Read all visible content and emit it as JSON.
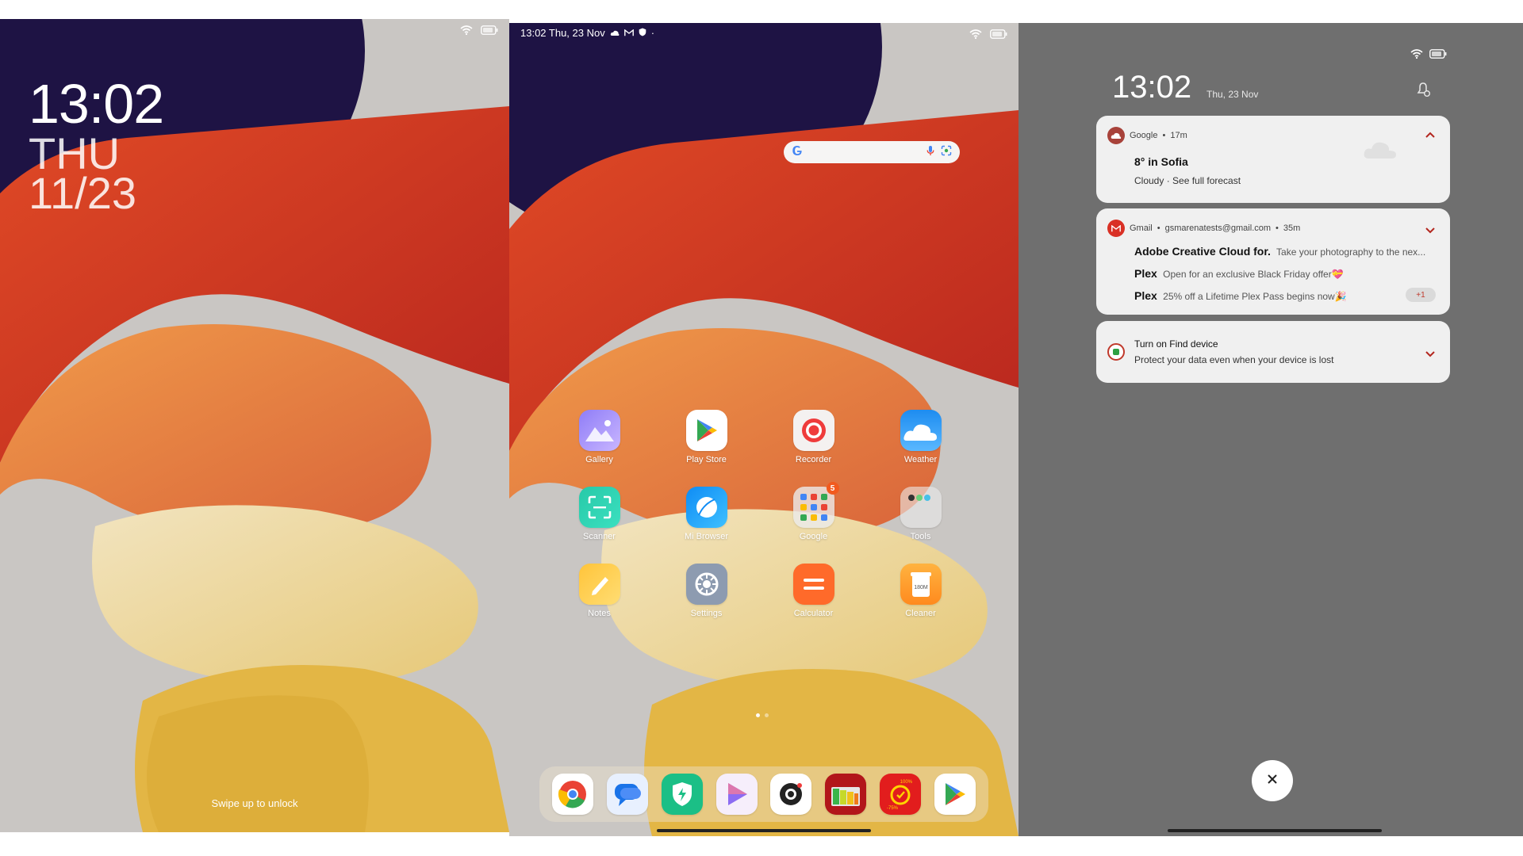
{
  "lock": {
    "time": "13:02",
    "day": "THU",
    "date": "11/23",
    "hint": "Swipe up to unlock"
  },
  "home": {
    "status": {
      "time_date": "13:02 Thu, 23 Nov",
      "extra": "·"
    },
    "apps": [
      {
        "label": "Gallery",
        "icon": "gallery-icon"
      },
      {
        "label": "Play Store",
        "icon": "play-store-icon"
      },
      {
        "label": "Recorder",
        "icon": "recorder-icon"
      },
      {
        "label": "Weather",
        "icon": "weather-icon"
      },
      {
        "label": "Scanner",
        "icon": "scanner-icon"
      },
      {
        "label": "Mi Browser",
        "icon": "browser-icon"
      },
      {
        "label": "Google",
        "icon": "google-folder-icon",
        "badge": "5"
      },
      {
        "label": "Tools",
        "icon": "tools-folder-icon"
      },
      {
        "label": "Notes",
        "icon": "notes-icon"
      },
      {
        "label": "Settings",
        "icon": "settings-icon"
      },
      {
        "label": "Calculator",
        "icon": "calculator-icon"
      },
      {
        "label": "Cleaner",
        "icon": "cleaner-icon",
        "icon_text": "180M"
      }
    ],
    "dock": [
      {
        "icon": "chrome-icon"
      },
      {
        "icon": "messages-icon"
      },
      {
        "icon": "security-icon"
      },
      {
        "icon": "video-player-icon"
      },
      {
        "icon": "camera-icon"
      },
      {
        "icon": "battery-widget-icon"
      },
      {
        "icon": "game-booster-icon",
        "icon_text_top": "100%",
        "icon_text_bottom": "-75%"
      },
      {
        "icon": "google-play-icon"
      }
    ]
  },
  "shade": {
    "time": "13:02",
    "date": "Thu, 23 Nov",
    "weather": {
      "source": "Google",
      "age": "17m",
      "title": "8° in Sofia",
      "text": "Cloudy · See full forecast"
    },
    "gmail": {
      "source": "Gmail",
      "account": "gsmarenatests@gmail.com",
      "age": "35m",
      "items": [
        {
          "sender": "Adobe Creative Cloud for.",
          "text": "Take your photography to the nex..."
        },
        {
          "sender": "Plex",
          "text": "Open for an exclusive Black Friday offer💝"
        },
        {
          "sender": "Plex",
          "text": "25% off a Lifetime Plex Pass begins now🎉"
        }
      ],
      "more": "+1"
    },
    "find": {
      "title": "Turn on Find device",
      "text": "Protect your data even when your device is lost"
    }
  },
  "colors": {
    "wall_bg": "#c9c6c3",
    "shade_bg": "#6f6f6f",
    "accent_red": "#c0392b",
    "dark_blue": "#1e1344"
  }
}
